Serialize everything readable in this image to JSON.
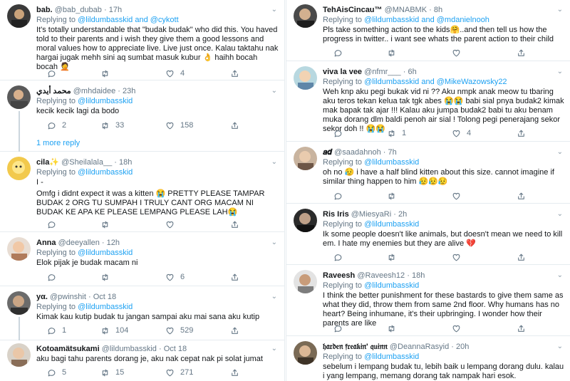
{
  "left": {
    "tweets": [
      {
        "name": "bab.",
        "handle": "@bab_dubab",
        "dot": "·",
        "time": "17h",
        "replying_prefix": "Replying to",
        "replying_to": "@lildumbasskid and @cykott",
        "text": "It's totally understandable that \"budak budak\" who did this. You haved told to their parents and i wish they give them a good lessons and moral values how to appreciate live. Live just once. Kalau taktahu nak hargai jugak mehh sini aq sumbat masuk kubur 👌 haihh bocah bocah 🤦",
        "reply_count": "",
        "retweet_count": "",
        "like_count": "4"
      },
      {
        "name": "محمد أيدي",
        "handle": "@mhdaidee",
        "dot": "·",
        "time": "23h",
        "replying_prefix": "Replying to",
        "replying_to": "@lildumbasskid",
        "text": "kecik kecik lagi da bodo",
        "reply_count": "2",
        "retweet_count": "33",
        "like_count": "158"
      },
      {
        "name": "cila✨",
        "handle": "@Sheilalala__",
        "dot": "·",
        "time": "18h",
        "replying_prefix": "Replying to",
        "replying_to": "@lildumbasskid",
        "text_line1": "I -",
        "text": "Omfg i didnt expect it was a kitten 😭 PRETTY PLEASE TAMPAR BUDAK 2 ORG TU SUMPAH I TRULY CANT ORG MACAM NI BUDAK KE APA KE PLEASE LEMPANG PLEASE LAH😭",
        "reply_count": "",
        "retweet_count": "",
        "like_count": ""
      },
      {
        "name": "Anna",
        "handle": "@deeyallen",
        "dot": "·",
        "time": "12h",
        "replying_prefix": "Replying to",
        "replying_to": "@lildumbasskid",
        "text": "Elok pijak je budak macam ni",
        "reply_count": "",
        "retweet_count": "",
        "like_count": "6"
      },
      {
        "name": "yα.",
        "handle": "@pwinshit",
        "dot": "·",
        "time": "Oct 18",
        "replying_prefix": "Replying to",
        "replying_to": "@lildumbasskid",
        "text": "Kimak kau kutip budak tu jangan sampai aku mai sana aku kutip",
        "reply_count": "1",
        "retweet_count": "104",
        "like_count": "529"
      },
      {
        "name": "Kotoamätsukami",
        "handle": "@lildumbasskid",
        "dot": "·",
        "time": "Oct 18",
        "replying_prefix": "",
        "replying_to": "",
        "text": "aku bagi tahu parents dorang je, aku nak cepat nak pi solat jumat",
        "reply_count": "5",
        "retweet_count": "15",
        "like_count": "271"
      }
    ],
    "more_replies": "1 more reply"
  },
  "right": {
    "tweets": [
      {
        "name": "TehAisCincau™",
        "handle": "@MNABMK",
        "dot": "·",
        "time": "8h",
        "replying_prefix": "Replying to",
        "replying_to": "@lildumbasskid and @mdanielnooh",
        "text": "Pls take something action to the kids🤗..and then tell us how the progress in twitter.. i want see whats the parent action to their child",
        "reply_count": "",
        "retweet_count": "",
        "like_count": ""
      },
      {
        "name": "viva la vee",
        "handle": "@nfmr___",
        "dot": "·",
        "time": "6h",
        "replying_prefix": "Replying to",
        "replying_to": "@lildumbasskid and @MikeWazowsky22",
        "text": "Weh knp aku pegi bukak vid ni ?? Aku nmpk anak meow tu tbaring aku teros tekan kelua tak tgk abes 😭😭 babi sial pnya budak2 kimak mak bapak tak ajar !!! Kalau aku jumpa budak2 babi tu aku benam muka dorang dlm baldi penoh air sial ! Tolong pegi penerajang sekor sekor doh !! 😭😭",
        "reply_count": "",
        "retweet_count": "1",
        "like_count": "4"
      },
      {
        "name": "𝒂𝒅",
        "handle": "@saadahnoh",
        "dot": "·",
        "time": "7h",
        "replying_prefix": "Replying to",
        "replying_to": "@lildumbasskid",
        "text": "oh no 😥 i have a half blind kitten about this size. cannot imagine if similar thing happen to him 😥😥😥",
        "reply_count": "",
        "retweet_count": "",
        "like_count": ""
      },
      {
        "name": "Ris Iris",
        "handle": "@MiesyaRi",
        "dot": "·",
        "time": "2h",
        "replying_prefix": "Replying to",
        "replying_to": "@lildumbasskid",
        "text": "Ik some people doesn't like animals, but doesn't mean we need to kill em. I hate my enemies but they are alive 💔",
        "reply_count": "",
        "retweet_count": "",
        "like_count": ""
      },
      {
        "name": "Raveesh",
        "handle": "@Raveesh12",
        "dot": "·",
        "time": "18h",
        "replying_prefix": "Replying to",
        "replying_to": "@lildumbasskid",
        "text": "I think the better punishment for these bastards to give them same as what they did, throw them from same 2nd floor. Why humans has no heart? Being inhumane, it's their upbringing. I wonder how their parents are like",
        "reply_count": "",
        "retweet_count": "",
        "like_count": ""
      },
      {
        "name": "𝔥𝔞𝔯𝔡𝔢𝔫 𝔣𝔯𝔢𝔞𝔨𝔦𝔫' 𝔮𝔲𝔦𝔫𝔫",
        "handle": "@DeannaRasyid",
        "dot": "·",
        "time": "20h",
        "replying_prefix": "Replying to",
        "replying_to": "@lildumbasskid",
        "text": "sebelum i lempang budak tu, lebih baik u lempang dorang dulu. kalau i yang lempang, memang dorang tak nampak hari esok.",
        "reply_count": "",
        "retweet_count": "",
        "like_count": ""
      }
    ]
  },
  "colors": {
    "link": "#1da1f2",
    "muted": "#657786",
    "border": "#e6ecf0",
    "text": "#14171a"
  },
  "icons": [
    "reply-icon",
    "retweet-icon",
    "like-icon",
    "share-icon",
    "caret-down-icon"
  ]
}
